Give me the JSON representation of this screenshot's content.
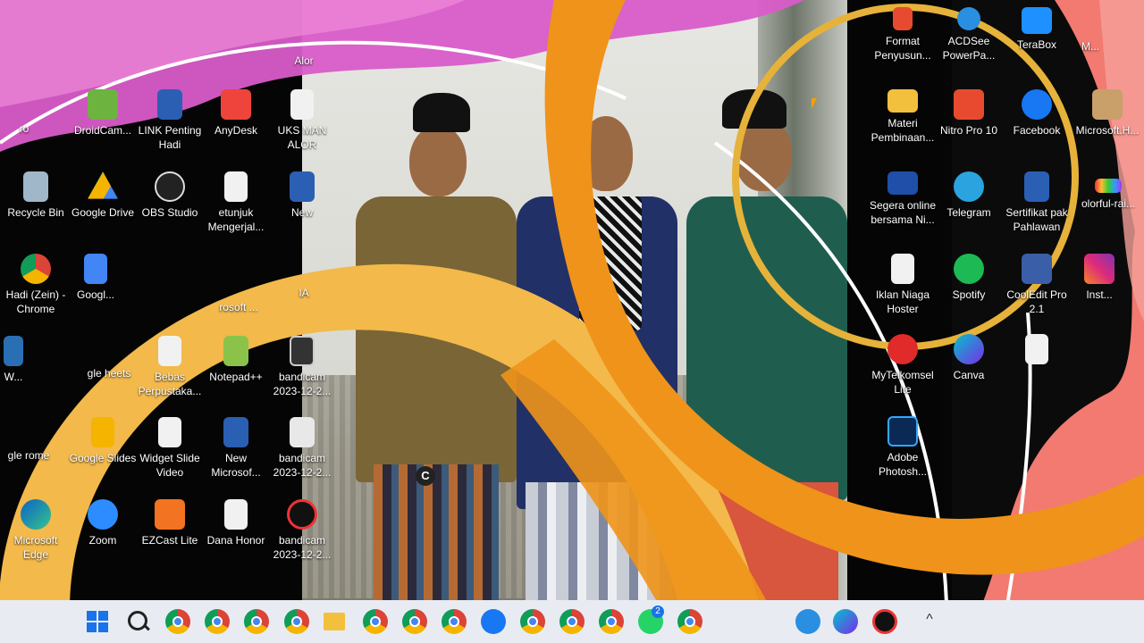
{
  "desktop": {
    "icons_left": [
      {
        "label": "Alor"
      },
      {
        "label": "ro"
      },
      {
        "label": "DroidCam..."
      },
      {
        "label": "LINK Penting Hadi"
      },
      {
        "label": "AnyDesk"
      },
      {
        "label": "UKS MAN ALOR"
      },
      {
        "label": "Recycle Bin"
      },
      {
        "label": "Google Drive"
      },
      {
        "label": "OBS Studio"
      },
      {
        "label": "etunjuk Mengerjal..."
      },
      {
        "label": "New"
      },
      {
        "label": "Hadi (Zein) - Chrome"
      },
      {
        "label": "Googl..."
      },
      {
        "label": "rosoft ..."
      },
      {
        "label": "IA"
      },
      {
        "label": "W..."
      },
      {
        "label": "gle heets"
      },
      {
        "label": "Bebas Perpustaka..."
      },
      {
        "label": "Notepad++"
      },
      {
        "label": "bandicam 2023-12-2..."
      },
      {
        "label": "gle rome"
      },
      {
        "label": "Google Slides"
      },
      {
        "label": "Widget Slide Video"
      },
      {
        "label": "New Microsof..."
      },
      {
        "label": "bandicam 2023-12-2..."
      },
      {
        "label": "Microsoft Edge"
      },
      {
        "label": "Zoom"
      },
      {
        "label": "EZCast Lite"
      },
      {
        "label": "Dana Honor"
      },
      {
        "label": "bandicam 2023-12-2..."
      }
    ],
    "icons_right": [
      {
        "label": "Format Penyusun..."
      },
      {
        "label": "ACDSee PowerPa..."
      },
      {
        "label": "TeraBox"
      },
      {
        "label": "M..."
      },
      {
        "label": "Materi Pembinaan..."
      },
      {
        "label": "Nitro Pro 10"
      },
      {
        "label": "Facebook"
      },
      {
        "label": "Microsoft.H..."
      },
      {
        "label": "Segera online bersama Ni..."
      },
      {
        "label": "Telegram"
      },
      {
        "label": "Sertifikat pak Pahlawan"
      },
      {
        "label": "olorful-rai..."
      },
      {
        "label": "Iklan Niaga Hoster"
      },
      {
        "label": "Spotify"
      },
      {
        "label": "CoolEdit Pro 2.1"
      },
      {
        "label": "Inst..."
      },
      {
        "label": "MyTelkomsel Lite"
      },
      {
        "label": "Canva"
      },
      {
        "label": "Adobe Photosh..."
      }
    ]
  },
  "video_overlay": {
    "cursor_badge": "C"
  },
  "taskbar": {
    "items": [
      {
        "name": "windows-start"
      },
      {
        "name": "search"
      },
      {
        "name": "chrome"
      },
      {
        "name": "chrome-profile-1"
      },
      {
        "name": "chrome-profile-2"
      },
      {
        "name": "chrome-profile-3"
      },
      {
        "name": "file-explorer"
      },
      {
        "name": "chrome-profile-4"
      },
      {
        "name": "chrome-profile-5"
      },
      {
        "name": "chrome-profile-6"
      },
      {
        "name": "facebook"
      },
      {
        "name": "chrome-profile-7"
      },
      {
        "name": "chrome-profile-8"
      },
      {
        "name": "chrome-profile-9"
      },
      {
        "name": "whatsapp"
      },
      {
        "name": "chrome-profile-10"
      }
    ],
    "whatsapp_badge": "2",
    "tray": [
      {
        "name": "acdsee"
      },
      {
        "name": "canva"
      },
      {
        "name": "bandicam-record"
      }
    ],
    "tray_chevron": "^"
  },
  "colors": {
    "accent_orange": "#f0931a",
    "accent_yellow": "#f3b94a",
    "pink": "#e05fc4",
    "coral": "#f27a70"
  }
}
